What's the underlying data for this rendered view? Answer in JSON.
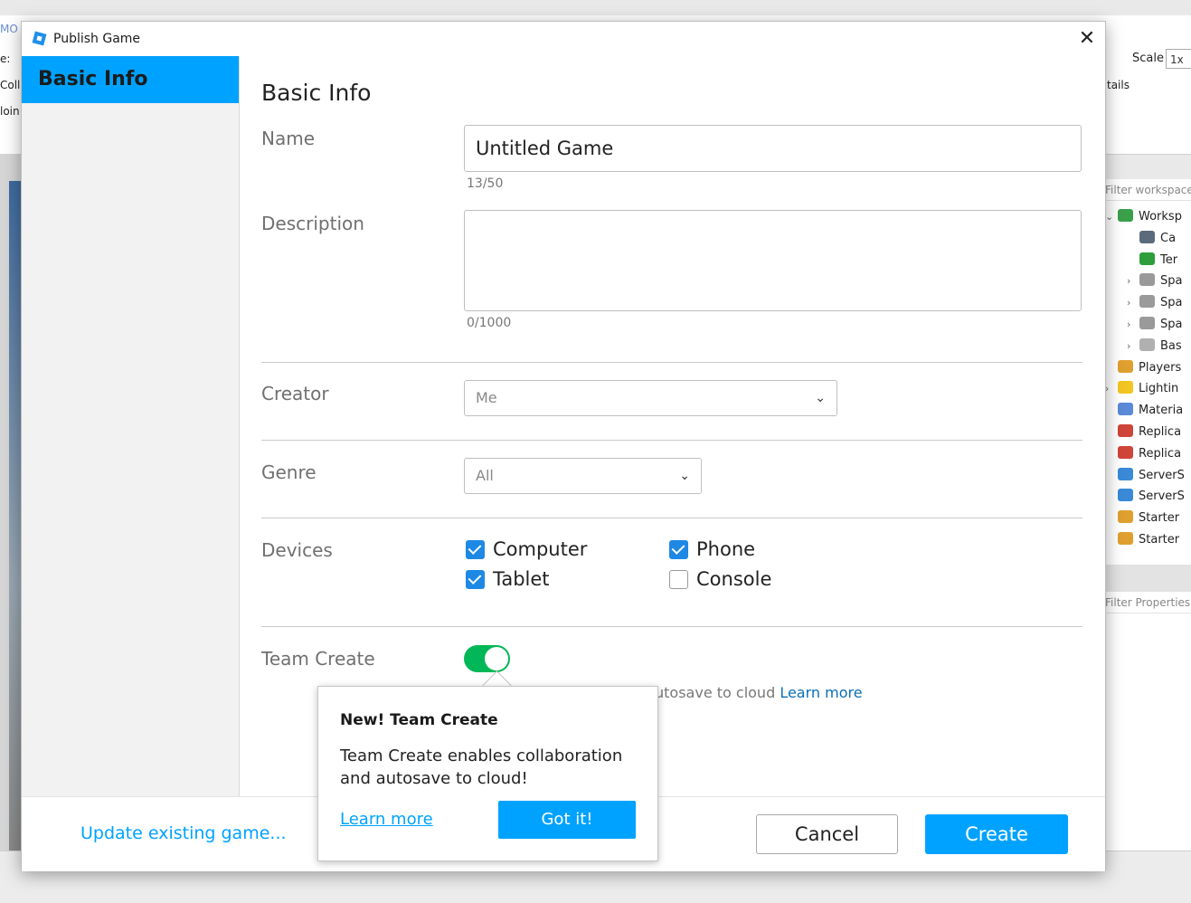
{
  "background": {
    "left_snippets": [
      "MO",
      "e:",
      "Colli",
      "loin"
    ],
    "scale_label": "Scale",
    "scale_value": "1x",
    "tails_label": "tails",
    "explorer_filter": "Filter workspace",
    "explorer_items": [
      {
        "label": "Worksp",
        "arrow": "⌄",
        "icon_color": "#3aa04a",
        "indent": 0
      },
      {
        "label": "Ca",
        "arrow": "",
        "icon_color": "#5b6b7b",
        "indent": 1
      },
      {
        "label": "Ter",
        "arrow": "",
        "icon_color": "#2e9e3a",
        "indent": 1
      },
      {
        "label": "Spa",
        "arrow": "›",
        "icon_color": "#9a9a9a",
        "indent": 1
      },
      {
        "label": "Spa",
        "arrow": "›",
        "icon_color": "#9a9a9a",
        "indent": 1
      },
      {
        "label": "Spa",
        "arrow": "›",
        "icon_color": "#9a9a9a",
        "indent": 1
      },
      {
        "label": "Bas",
        "arrow": "›",
        "icon_color": "#b0b0b0",
        "indent": 1
      },
      {
        "label": "Players",
        "arrow": "",
        "icon_color": "#e0a030",
        "indent": 0
      },
      {
        "label": "Lightin",
        "arrow": "›",
        "icon_color": "#f2c522",
        "indent": 0
      },
      {
        "label": "Materia",
        "arrow": "",
        "icon_color": "#5b8ad8",
        "indent": 0
      },
      {
        "label": "Replica",
        "arrow": "",
        "icon_color": "#d0453a",
        "indent": 0
      },
      {
        "label": "Replica",
        "arrow": "",
        "icon_color": "#d0453a",
        "indent": 0
      },
      {
        "label": "ServerS",
        "arrow": "",
        "icon_color": "#3a8ad8",
        "indent": 0
      },
      {
        "label": "ServerS",
        "arrow": "",
        "icon_color": "#3a8ad8",
        "indent": 0
      },
      {
        "label": "Starter",
        "arrow": "",
        "icon_color": "#e0a030",
        "indent": 0
      },
      {
        "label": "Starter",
        "arrow": "",
        "icon_color": "#e0a030",
        "indent": 0
      }
    ],
    "properties_filter": "Filter Properties"
  },
  "dialog": {
    "title": "Publish Game",
    "close_glyph": "✕",
    "sidebar_active": "Basic Info",
    "heading": "Basic Info",
    "name_label": "Name",
    "name_value": "Untitled Game",
    "name_counter": "13/50",
    "description_label": "Description",
    "description_value": "",
    "description_counter": "0/1000",
    "creator_label": "Creator",
    "creator_value": "Me",
    "genre_label": "Genre",
    "genre_value": "All",
    "chevron": "⌄",
    "devices_label": "Devices",
    "devices": [
      {
        "label": "Computer",
        "checked": true
      },
      {
        "label": "Phone",
        "checked": true
      },
      {
        "label": "Tablet",
        "checked": true
      },
      {
        "label": "Console",
        "checked": false
      }
    ],
    "team_create_label": "Team Create",
    "team_create_on": true,
    "help_text_visible": "utosave to cloud",
    "help_link": "Learn more",
    "update_link": "Update existing game...",
    "cancel_label": "Cancel",
    "create_label": "Create"
  },
  "popover": {
    "title": "New! Team Create",
    "body": "Team Create enables collaboration and autosave to cloud!",
    "learn_more": "Learn more",
    "got_it": "Got it!"
  },
  "colors": {
    "accent": "#00a2ff",
    "toggle_on": "#02b757",
    "checkbox": "#1e88e5"
  }
}
